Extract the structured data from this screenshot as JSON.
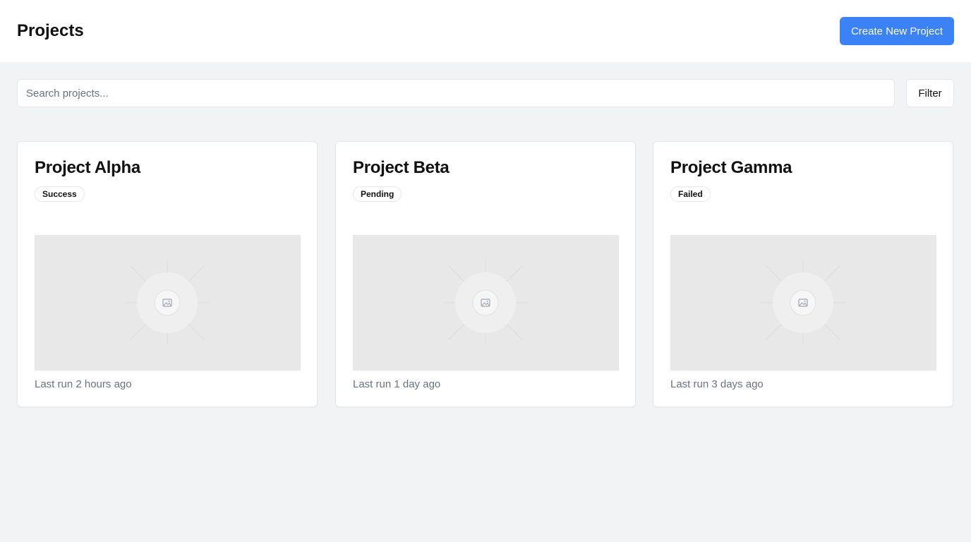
{
  "header": {
    "title": "Projects",
    "create_button_label": "Create New Project",
    "accent_color": "#3b82f6"
  },
  "toolbar": {
    "search_placeholder": "Search projects...",
    "search_value": "",
    "filter_label": "Filter"
  },
  "projects": [
    {
      "title": "Project Alpha",
      "status": "Success",
      "last_run": "Last run 2 hours ago",
      "thumbnail_icon": "image-placeholder-icon"
    },
    {
      "title": "Project Beta",
      "status": "Pending",
      "last_run": "Last run 1 day ago",
      "thumbnail_icon": "image-placeholder-icon"
    },
    {
      "title": "Project Gamma",
      "status": "Failed",
      "last_run": "Last run 3 days ago",
      "thumbnail_icon": "image-placeholder-icon"
    }
  ]
}
